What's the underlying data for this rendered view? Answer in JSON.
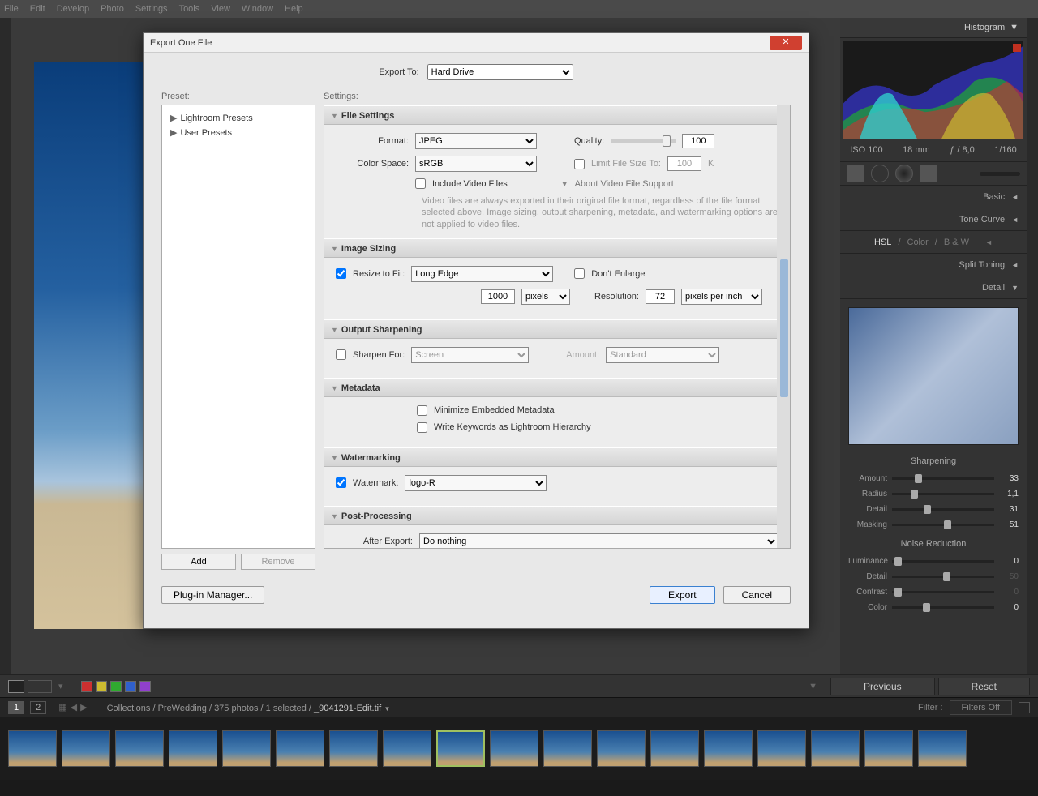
{
  "menu": [
    "File",
    "Edit",
    "Develop",
    "Photo",
    "Settings",
    "Tools",
    "View",
    "Window",
    "Help"
  ],
  "right_panel": {
    "histogram_label": "Histogram",
    "iso": "ISO 100",
    "focal": "18 mm",
    "aperture": "ƒ / 8,0",
    "shutter": "1/160",
    "sections": [
      "Basic",
      "Tone Curve",
      "Split Toning",
      "Detail"
    ],
    "hsl": {
      "a": "HSL",
      "b": "Color",
      "c": "B & W"
    },
    "sharpening_title": "Sharpening",
    "sharpen_sliders": [
      {
        "lbl": "Amount",
        "val": "33",
        "pos": 22
      },
      {
        "lbl": "Radius",
        "val": "1,1",
        "pos": 18
      },
      {
        "lbl": "Detail",
        "val": "31",
        "pos": 31
      },
      {
        "lbl": "Masking",
        "val": "51",
        "pos": 51
      }
    ],
    "noise_title": "Noise Reduction",
    "noise_sliders": [
      {
        "lbl": "Luminance",
        "val": "0",
        "pos": 2,
        "dim": false
      },
      {
        "lbl": "Detail",
        "val": "50",
        "pos": 50,
        "dim": true
      },
      {
        "lbl": "Contrast",
        "val": "0",
        "pos": 2,
        "dim": true
      },
      {
        "lbl": "Color",
        "val": "0",
        "pos": 30,
        "dim": false
      }
    ]
  },
  "bottom_toolbar": {
    "prev": "Previous",
    "reset": "Reset"
  },
  "breadcrumb": {
    "pages": [
      "1",
      "2"
    ],
    "path": "Collections / PreWedding / 375 photos / 1 selected / ",
    "file": "_9041291-Edit.tif",
    "filter_lbl": "Filter :",
    "filter_val": "Filters Off"
  },
  "dialog": {
    "title": "Export One File",
    "export_to_lbl": "Export To:",
    "export_to_val": "Hard Drive",
    "preset_lbl": "Preset:",
    "settings_lbl": "Settings:",
    "presets": [
      "Lightroom Presets",
      "User Presets"
    ],
    "add": "Add",
    "remove": "Remove",
    "plugin": "Plug-in Manager...",
    "export": "Export",
    "cancel": "Cancel",
    "file_settings": {
      "head": "File Settings",
      "format_lbl": "Format:",
      "format_val": "JPEG",
      "quality_lbl": "Quality:",
      "quality_val": "100",
      "color_lbl": "Color Space:",
      "color_val": "sRGB",
      "limit_lbl": "Limit File Size To:",
      "limit_val": "100",
      "limit_unit": "K",
      "include_video": "Include Video Files",
      "about_video": "About Video File Support",
      "video_info": "Video files are always exported in their original file format, regardless of the file format selected above. Image sizing, output sharpening, metadata, and watermarking options are not applied to video files."
    },
    "sizing": {
      "head": "Image Sizing",
      "resize_lbl": "Resize to Fit:",
      "resize_val": "Long Edge",
      "dont_enlarge": "Don't Enlarge",
      "size_val": "1000",
      "size_unit": "pixels",
      "res_lbl": "Resolution:",
      "res_val": "72",
      "res_unit": "pixels per inch"
    },
    "sharpen": {
      "head": "Output Sharpening",
      "sharpen_lbl": "Sharpen For:",
      "sharpen_val": "Screen",
      "amount_lbl": "Amount:",
      "amount_val": "Standard"
    },
    "metadata": {
      "head": "Metadata",
      "minimize": "Minimize Embedded Metadata",
      "keywords": "Write Keywords as Lightroom Hierarchy"
    },
    "watermark": {
      "head": "Watermarking",
      "lbl": "Watermark:",
      "val": "logo-R"
    },
    "post": {
      "head": "Post-Processing",
      "after_lbl": "After Export:",
      "after_val": "Do nothing"
    }
  }
}
